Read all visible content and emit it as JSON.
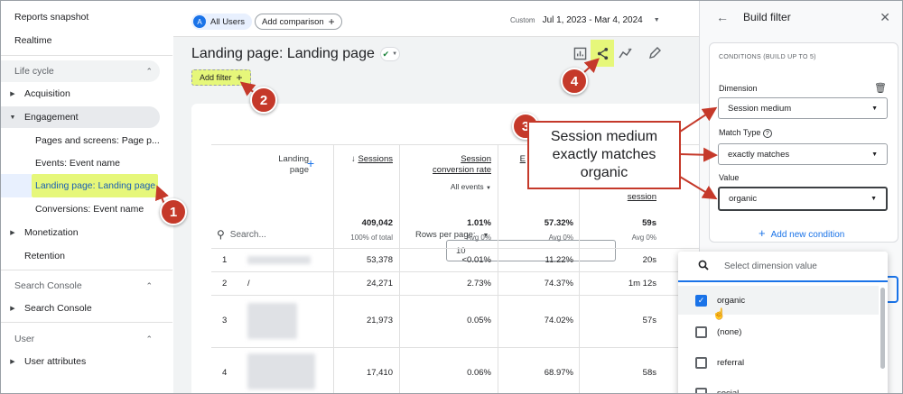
{
  "sidebar": {
    "top_items": [
      "Reports snapshot",
      "Realtime"
    ],
    "section_lifecycle": "Life cycle",
    "acquisition": "Acquisition",
    "engagement": "Engagement",
    "sub_items": [
      "Pages and screens: Page p...",
      "Events: Event name",
      "Landing page: Landing page",
      "Conversions: Event name"
    ],
    "monetization": "Monetization",
    "retention": "Retention",
    "section_search": "Search Console",
    "search_console": "Search Console",
    "section_user": "User",
    "user_attributes": "User attributes"
  },
  "topbar": {
    "avatar_letter": "A",
    "all_users": "All Users",
    "add_comparison": "Add comparison",
    "date_label": "Custom",
    "date_range": "Jul 1, 2023 - Mar 4, 2024"
  },
  "report": {
    "title": "Landing page: Landing page",
    "add_filter": "Add filter",
    "search_placeholder": "Search...",
    "rows_per_page_label": "Rows per page:",
    "rows_per_page_value": "10"
  },
  "table": {
    "dim_header": "Landing page",
    "col_sessions": "Sessions",
    "col_conv_rate": "Session conversion rate",
    "col_conv_sub": "All events",
    "col_b": "E",
    "col_session": "session",
    "totals": [
      "409,042",
      "1.01%",
      "57.32%",
      "59s"
    ],
    "totals_sub": [
      "100% of total",
      "Avg 0%",
      "Avg 0%",
      "Avg 0%"
    ],
    "rows": [
      {
        "n": "1",
        "page": "",
        "sessions": "53,378",
        "conv": "<0.01%",
        "b": "11.22%",
        "d": "20s"
      },
      {
        "n": "2",
        "page": "/",
        "sessions": "24,271",
        "conv": "2.73%",
        "b": "74.37%",
        "d": "1m 12s"
      },
      {
        "n": "3",
        "page": "",
        "sessions": "21,973",
        "conv": "0.05%",
        "b": "74.02%",
        "d": "57s"
      },
      {
        "n": "4",
        "page": "",
        "sessions": "17,410",
        "conv": "0.06%",
        "b": "68.97%",
        "d": "58s"
      }
    ]
  },
  "panel": {
    "title": "Build filter",
    "conditions_header": "CONDITIONS (BUILD UP TO 5)",
    "dimension_label": "Dimension",
    "dimension_value": "Session medium",
    "match_label": "Match Type",
    "match_value": "exactly matches",
    "value_label": "Value",
    "value_value": "organic",
    "add_condition": "Add new condition"
  },
  "dropdown": {
    "placeholder": "Select dimension value",
    "options": [
      {
        "label": "organic",
        "checked": true
      },
      {
        "label": "(none)",
        "checked": false
      },
      {
        "label": "referral",
        "checked": false
      },
      {
        "label": "social",
        "checked": false
      }
    ]
  },
  "annotations": {
    "badges": [
      "1",
      "2",
      "3",
      "4"
    ],
    "callout": "Session medium exactly matches organic"
  },
  "colors": {
    "accent": "#1a73e8",
    "annotation": "#c5392a",
    "highlight": "#e6f77a"
  }
}
